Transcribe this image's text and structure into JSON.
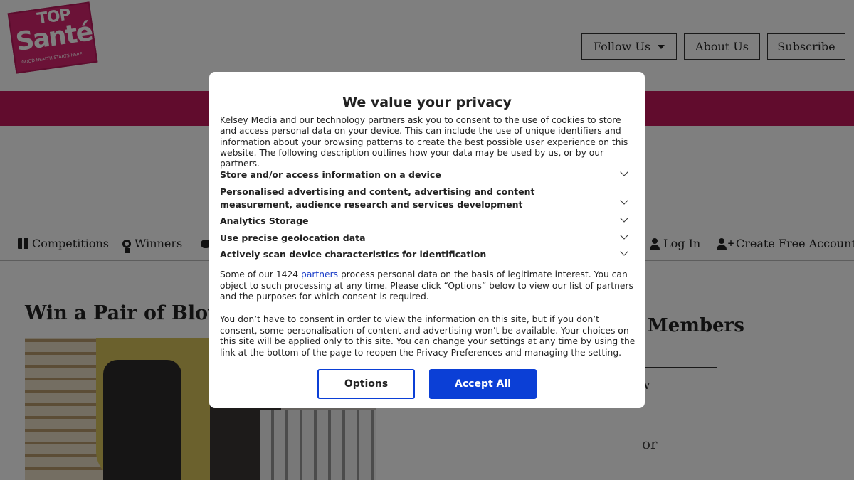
{
  "site": {
    "logo": {
      "top_text": "TOP",
      "main_text": "Santé",
      "tagline": "GOOD HEALTH STARTS HERE"
    },
    "header_buttons": {
      "follow_us": "Follow Us",
      "about_us": "About Us",
      "subscribe": "Subscribe"
    },
    "nav": {
      "competitions": "Competitions",
      "winners": "Winners",
      "log_in": "Log In",
      "create_account": "Create Free Account"
    },
    "article": {
      "title": "Win a Pair of Blowf"
    },
    "sidebar": {
      "members_title": "Members",
      "join_button": "n Now",
      "or_text": "or"
    }
  },
  "consent": {
    "title": "We value your privacy",
    "intro": "Kelsey Media and our technology partners ask you to consent to the use of cookies to store and access personal data on your device. This can include the use of unique identifiers and information about your browsing patterns to create the best possible user experience on this website. The following description outlines how your data may be used by us, or by our partners.",
    "purposes": [
      "Store and/or access information on a device",
      "Personalised advertising and content, advertising and content measurement, audience research and services development",
      "Analytics Storage",
      "Use precise geolocation data",
      "Actively scan device characteristics for identification"
    ],
    "legit_prefix": "Some of our 1424 ",
    "legit_link": "partners",
    "legit_suffix": " process personal data on the basis of legitimate interest. You can object to such processing at any time. Please click “Options” below to view our list of partners and the purposes for which consent is required.",
    "no_consent": "You don’t have to consent in order to view the information on this site, but if you don’t consent, some personalisation of content and advertising won’t be available. Your choices on this site will be applied only to this site. You can change your settings at any time by using the link at the bottom of the page to reopen the Privacy Preferences and managing the setting.",
    "options_button": "Options",
    "accept_button": "Accept All"
  },
  "colors": {
    "brand_pink": "#c2185b",
    "accept_blue": "#0b3fd6",
    "link_blue": "#1a3dc8"
  },
  "icons": [
    "gift-icon",
    "medal-icon",
    "chat-icon",
    "user-icon",
    "user-plus-icon",
    "caret-down-icon",
    "chevron-down-icon"
  ]
}
